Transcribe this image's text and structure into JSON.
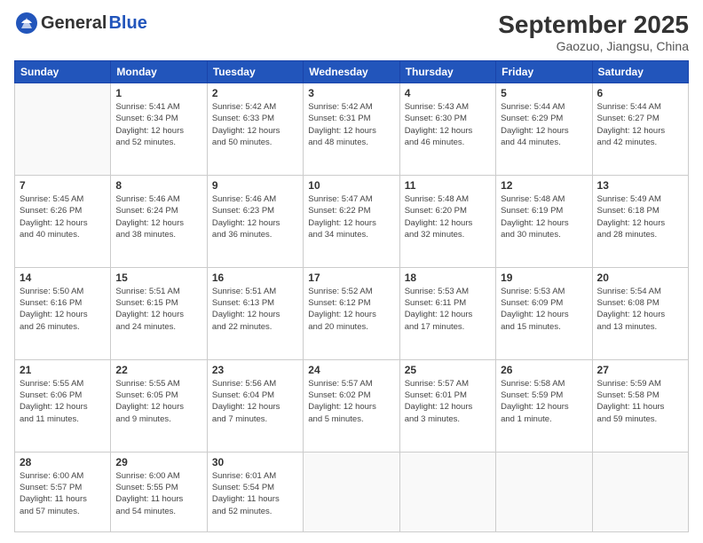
{
  "logo": {
    "general": "General",
    "blue": "Blue"
  },
  "title": "September 2025",
  "subtitle": "Gaozuo, Jiangsu, China",
  "days_header": [
    "Sunday",
    "Monday",
    "Tuesday",
    "Wednesday",
    "Thursday",
    "Friday",
    "Saturday"
  ],
  "weeks": [
    [
      {
        "day": "",
        "info": ""
      },
      {
        "day": "1",
        "info": "Sunrise: 5:41 AM\nSunset: 6:34 PM\nDaylight: 12 hours\nand 52 minutes."
      },
      {
        "day": "2",
        "info": "Sunrise: 5:42 AM\nSunset: 6:33 PM\nDaylight: 12 hours\nand 50 minutes."
      },
      {
        "day": "3",
        "info": "Sunrise: 5:42 AM\nSunset: 6:31 PM\nDaylight: 12 hours\nand 48 minutes."
      },
      {
        "day": "4",
        "info": "Sunrise: 5:43 AM\nSunset: 6:30 PM\nDaylight: 12 hours\nand 46 minutes."
      },
      {
        "day": "5",
        "info": "Sunrise: 5:44 AM\nSunset: 6:29 PM\nDaylight: 12 hours\nand 44 minutes."
      },
      {
        "day": "6",
        "info": "Sunrise: 5:44 AM\nSunset: 6:27 PM\nDaylight: 12 hours\nand 42 minutes."
      }
    ],
    [
      {
        "day": "7",
        "info": "Sunrise: 5:45 AM\nSunset: 6:26 PM\nDaylight: 12 hours\nand 40 minutes."
      },
      {
        "day": "8",
        "info": "Sunrise: 5:46 AM\nSunset: 6:24 PM\nDaylight: 12 hours\nand 38 minutes."
      },
      {
        "day": "9",
        "info": "Sunrise: 5:46 AM\nSunset: 6:23 PM\nDaylight: 12 hours\nand 36 minutes."
      },
      {
        "day": "10",
        "info": "Sunrise: 5:47 AM\nSunset: 6:22 PM\nDaylight: 12 hours\nand 34 minutes."
      },
      {
        "day": "11",
        "info": "Sunrise: 5:48 AM\nSunset: 6:20 PM\nDaylight: 12 hours\nand 32 minutes."
      },
      {
        "day": "12",
        "info": "Sunrise: 5:48 AM\nSunset: 6:19 PM\nDaylight: 12 hours\nand 30 minutes."
      },
      {
        "day": "13",
        "info": "Sunrise: 5:49 AM\nSunset: 6:18 PM\nDaylight: 12 hours\nand 28 minutes."
      }
    ],
    [
      {
        "day": "14",
        "info": "Sunrise: 5:50 AM\nSunset: 6:16 PM\nDaylight: 12 hours\nand 26 minutes."
      },
      {
        "day": "15",
        "info": "Sunrise: 5:51 AM\nSunset: 6:15 PM\nDaylight: 12 hours\nand 24 minutes."
      },
      {
        "day": "16",
        "info": "Sunrise: 5:51 AM\nSunset: 6:13 PM\nDaylight: 12 hours\nand 22 minutes."
      },
      {
        "day": "17",
        "info": "Sunrise: 5:52 AM\nSunset: 6:12 PM\nDaylight: 12 hours\nand 20 minutes."
      },
      {
        "day": "18",
        "info": "Sunrise: 5:53 AM\nSunset: 6:11 PM\nDaylight: 12 hours\nand 17 minutes."
      },
      {
        "day": "19",
        "info": "Sunrise: 5:53 AM\nSunset: 6:09 PM\nDaylight: 12 hours\nand 15 minutes."
      },
      {
        "day": "20",
        "info": "Sunrise: 5:54 AM\nSunset: 6:08 PM\nDaylight: 12 hours\nand 13 minutes."
      }
    ],
    [
      {
        "day": "21",
        "info": "Sunrise: 5:55 AM\nSunset: 6:06 PM\nDaylight: 12 hours\nand 11 minutes."
      },
      {
        "day": "22",
        "info": "Sunrise: 5:55 AM\nSunset: 6:05 PM\nDaylight: 12 hours\nand 9 minutes."
      },
      {
        "day": "23",
        "info": "Sunrise: 5:56 AM\nSunset: 6:04 PM\nDaylight: 12 hours\nand 7 minutes."
      },
      {
        "day": "24",
        "info": "Sunrise: 5:57 AM\nSunset: 6:02 PM\nDaylight: 12 hours\nand 5 minutes."
      },
      {
        "day": "25",
        "info": "Sunrise: 5:57 AM\nSunset: 6:01 PM\nDaylight: 12 hours\nand 3 minutes."
      },
      {
        "day": "26",
        "info": "Sunrise: 5:58 AM\nSunset: 5:59 PM\nDaylight: 12 hours\nand 1 minute."
      },
      {
        "day": "27",
        "info": "Sunrise: 5:59 AM\nSunset: 5:58 PM\nDaylight: 11 hours\nand 59 minutes."
      }
    ],
    [
      {
        "day": "28",
        "info": "Sunrise: 6:00 AM\nSunset: 5:57 PM\nDaylight: 11 hours\nand 57 minutes."
      },
      {
        "day": "29",
        "info": "Sunrise: 6:00 AM\nSunset: 5:55 PM\nDaylight: 11 hours\nand 54 minutes."
      },
      {
        "day": "30",
        "info": "Sunrise: 6:01 AM\nSunset: 5:54 PM\nDaylight: 11 hours\nand 52 minutes."
      },
      {
        "day": "",
        "info": ""
      },
      {
        "day": "",
        "info": ""
      },
      {
        "day": "",
        "info": ""
      },
      {
        "day": "",
        "info": ""
      }
    ]
  ]
}
